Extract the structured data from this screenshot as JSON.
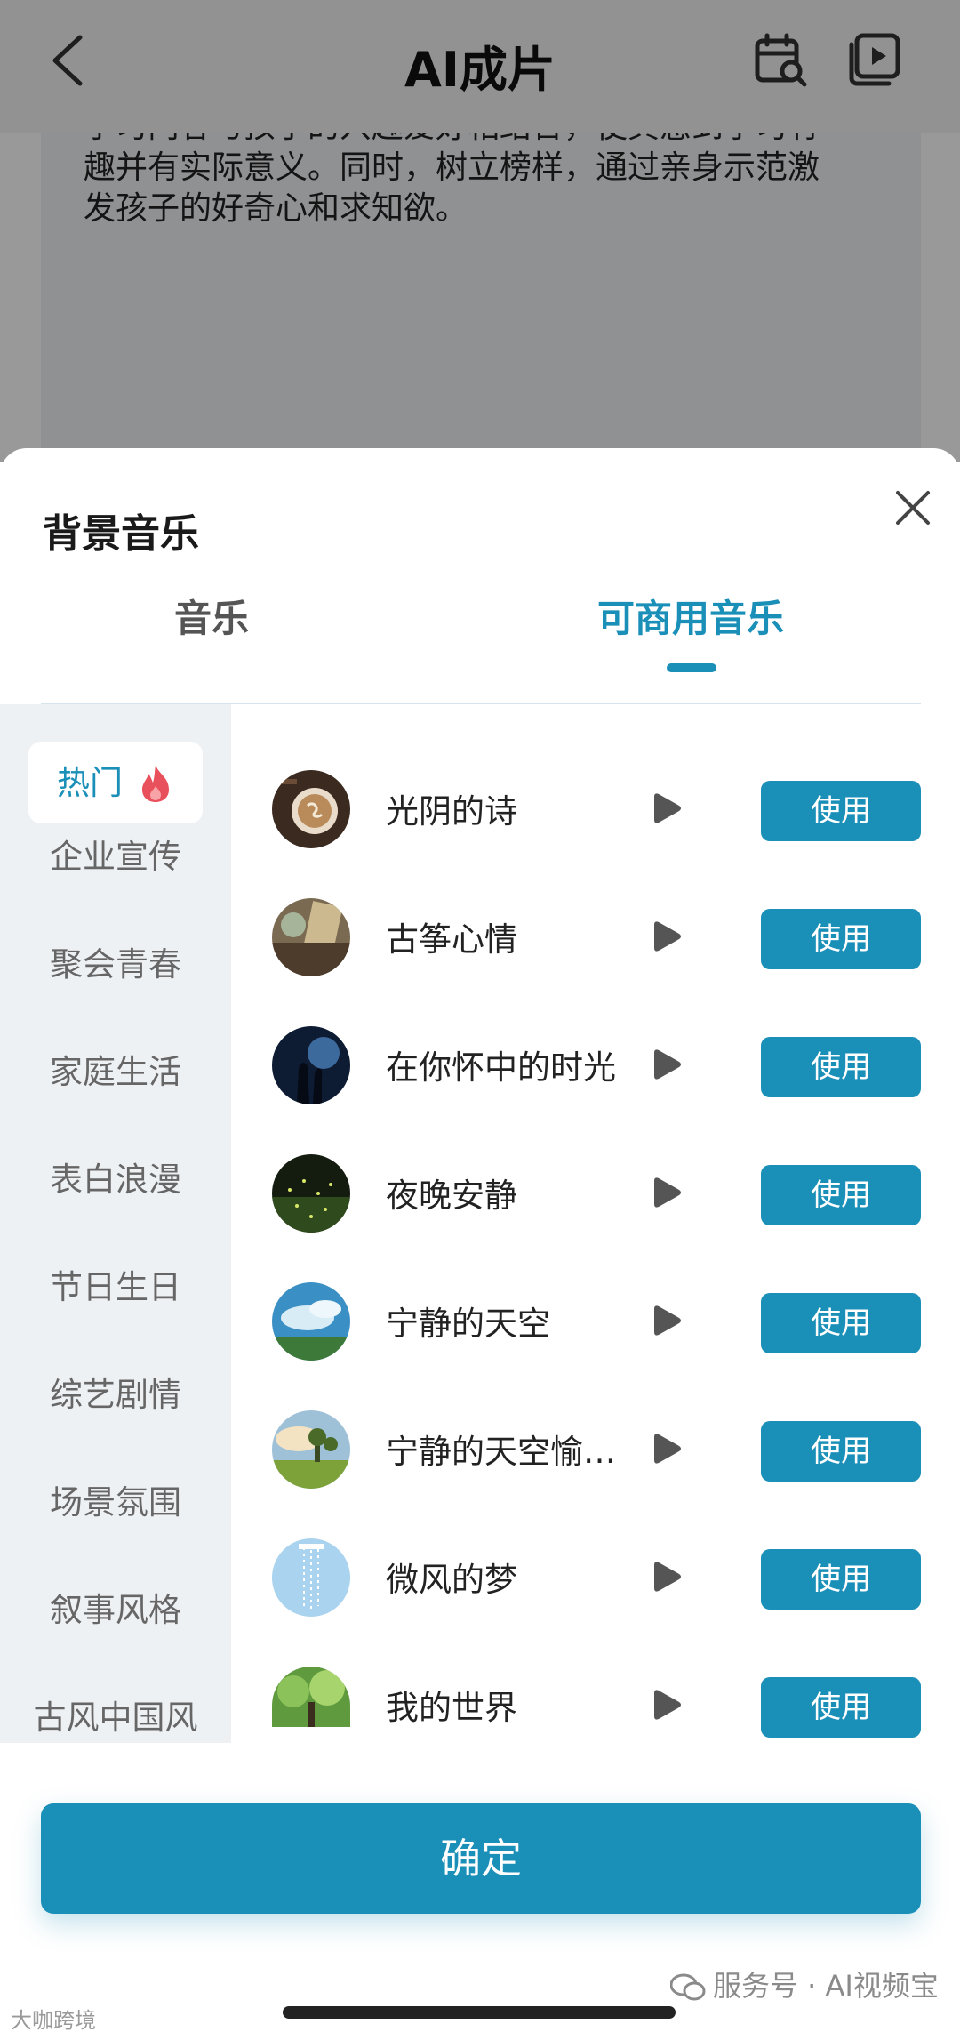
{
  "header": {
    "title": "AI成片"
  },
  "background_text": {
    "clipped_line": "学习内容与孩子的兴趣爱好相结合，使其感到学习有",
    "lines": [
      "趣并有实际意义。同时，树立榜样，通过亲身示范激",
      "发孩子的好奇心和求知欲。"
    ]
  },
  "sheet": {
    "title": "背景音乐",
    "tabs": [
      {
        "label": "音乐",
        "active": false
      },
      {
        "label": "可商用音乐",
        "active": true
      }
    ],
    "categories": [
      {
        "label": "热门",
        "active": true
      },
      {
        "label": "企业宣传"
      },
      {
        "label": "聚会青春"
      },
      {
        "label": "家庭生活"
      },
      {
        "label": "表白浪漫"
      },
      {
        "label": "节日生日"
      },
      {
        "label": "综艺剧情"
      },
      {
        "label": "场景氛围"
      },
      {
        "label": "叙事风格"
      },
      {
        "label": "古风中国风"
      }
    ],
    "songs": [
      {
        "name": "光阴的诗",
        "button": "使用",
        "thumb": "coffee"
      },
      {
        "name": "古筝心情",
        "button": "使用",
        "thumb": "book"
      },
      {
        "name": "在你怀中的时光",
        "button": "使用",
        "thumb": "silhouette"
      },
      {
        "name": "夜晚安静",
        "button": "使用",
        "thumb": "fireflies"
      },
      {
        "name": "宁静的天空",
        "button": "使用",
        "thumb": "sky"
      },
      {
        "name": "宁静的天空愉…",
        "button": "使用",
        "thumb": "tree-field"
      },
      {
        "name": "微风的梦",
        "button": "使用",
        "thumb": "wind-chime"
      },
      {
        "name": "我的世界",
        "button": "使用",
        "thumb": "forest"
      }
    ],
    "confirm": "确定"
  },
  "watermark": {
    "left": "大咖跨境",
    "right": "服务号 · AI视频宝"
  },
  "colors": {
    "accent": "#1a8fb8",
    "fire": "#e8505b"
  }
}
